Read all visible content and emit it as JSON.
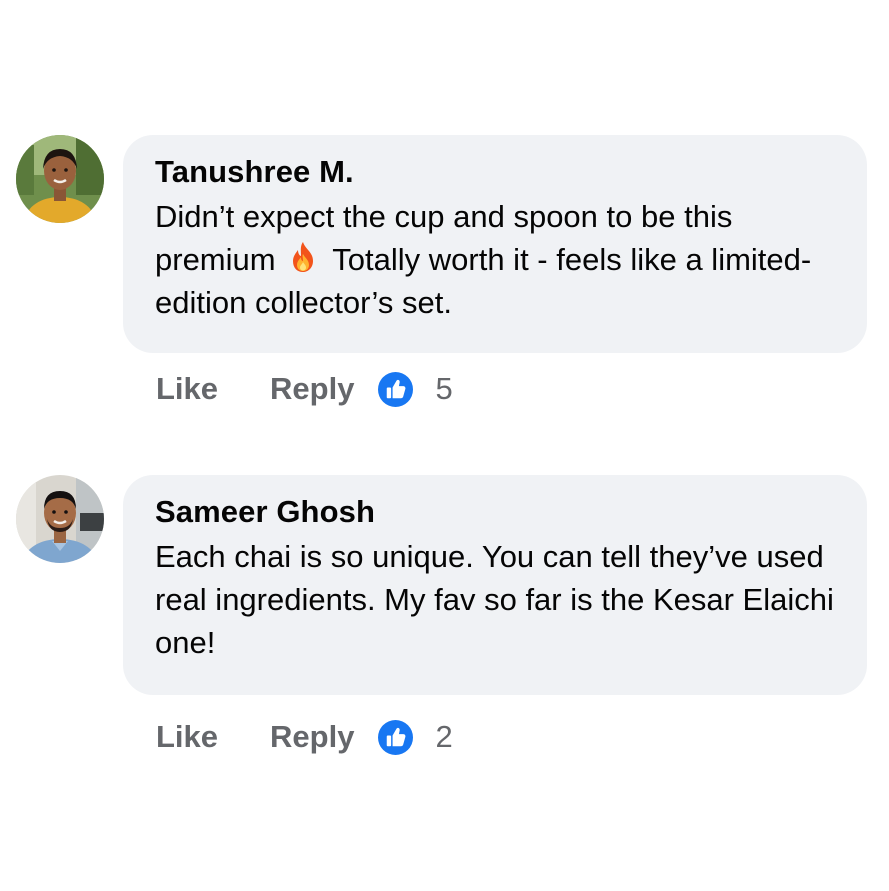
{
  "colors": {
    "bubble_bg": "#f0f2f5",
    "action_text": "#65676b",
    "like_blue": "#1877f2"
  },
  "comments": [
    {
      "author": "Tanushree M.",
      "avatar_icon": "avatar-photo-woman",
      "text_before_emoji": "Didn’t expect the cup and spoon to be this premium",
      "emoji": "fire-emoji",
      "text_after_emoji": "Totally worth it - feels like a limited-edition collector’s set.",
      "like_label": "Like",
      "reply_label": "Reply",
      "reaction_icon": "thumbs-up-icon",
      "like_count": "5"
    },
    {
      "author": "Sameer Ghosh",
      "avatar_icon": "avatar-photo-man",
      "text": "Each chai is so unique. You can tell they’ve used real ingredients. My fav so far is the Kesar Elaichi one!",
      "like_label": "Like",
      "reply_label": "Reply",
      "reaction_icon": "thumbs-up-icon",
      "like_count": "2"
    }
  ]
}
